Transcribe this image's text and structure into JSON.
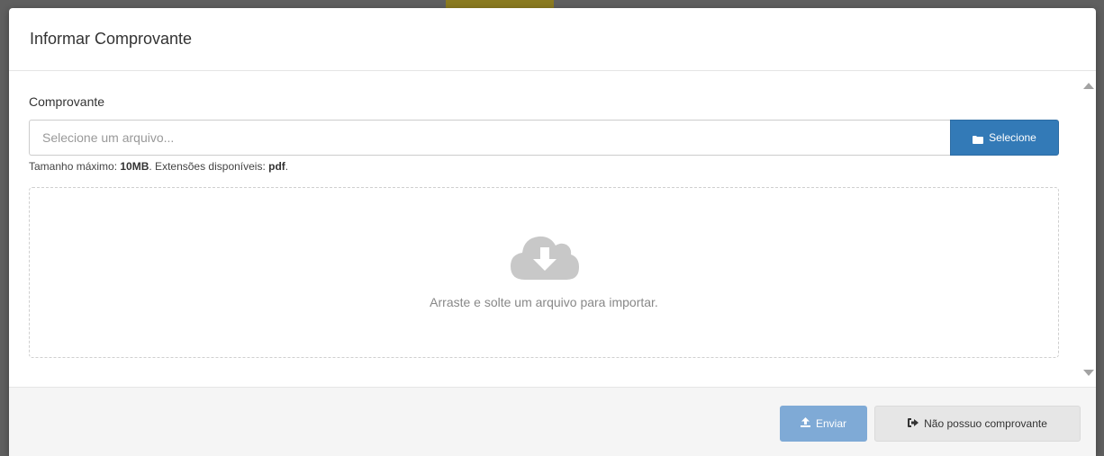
{
  "modal": {
    "title": "Informar Comprovante"
  },
  "form": {
    "label": "Comprovante",
    "file_input": {
      "placeholder": "Selecione um arquivo...",
      "value": ""
    },
    "select_button": {
      "label": "Selecione",
      "icon": "folder-icon"
    },
    "help": {
      "max_size_prefix": "Tamanho máximo: ",
      "max_size_value": "10MB",
      "extensions_prefix": ". Extensões disponíveis: ",
      "extensions_value": "pdf",
      "suffix": "."
    },
    "dropzone": {
      "icon": "cloud-download-icon",
      "text": "Arraste e solte um arquivo para importar."
    }
  },
  "footer": {
    "submit_button": {
      "label": "Enviar",
      "icon": "upload-icon",
      "disabled": true
    },
    "no_receipt_button": {
      "label": "Não possuo comprovante",
      "icon": "sign-out-icon"
    }
  },
  "colors": {
    "primary": "#337ab7",
    "primary_disabled": "#7faad6",
    "secondary": "#e6e6e6",
    "footer_bg": "#f5f5f5"
  }
}
